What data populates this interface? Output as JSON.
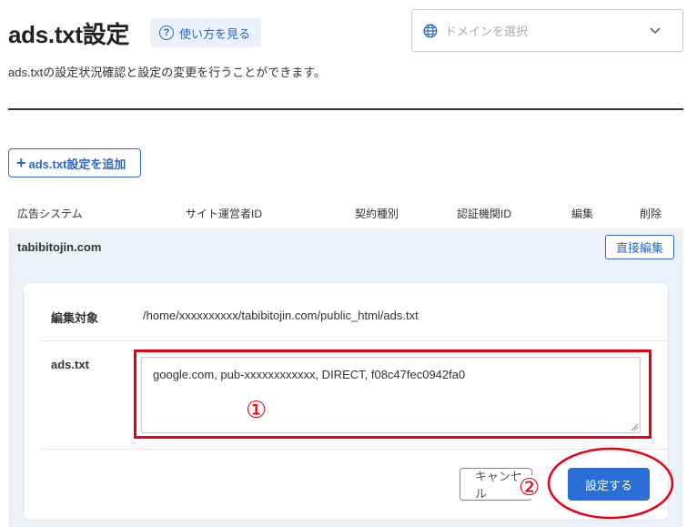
{
  "header": {
    "title": "ads.txt設定",
    "help_label": "使い方を見る",
    "domain_placeholder": "ドメインを選択",
    "description": "ads.txtの設定状況確認と設定の変更を行うことができます。"
  },
  "toolbar": {
    "add_label": "ads.txt設定を追加"
  },
  "table": {
    "columns": [
      "広告システム",
      "サイト運営者ID",
      "契約種別",
      "認証機関ID",
      "編集",
      "削除"
    ]
  },
  "site": {
    "name": "tabibitojin.com",
    "direct_edit_label": "直接編集"
  },
  "editor": {
    "target_label": "編集対象",
    "target_path": "/home/xxxxxxxxxx/tabibitojin.com/public_html/ads.txt",
    "adstxt_label": "ads.txt",
    "adstxt_value": "google.com, pub-xxxxxxxxxxxx, DIRECT, f08c47fec0942fa0",
    "cancel_label": "キャンセル",
    "submit_label": "設定する"
  },
  "annotations": {
    "mark1": "①",
    "mark2": "②",
    "color": "#e60012"
  },
  "colors": {
    "accent": "#2b67c4",
    "primary_button": "#2b6fd6",
    "row_bg": "#edf2f9"
  }
}
